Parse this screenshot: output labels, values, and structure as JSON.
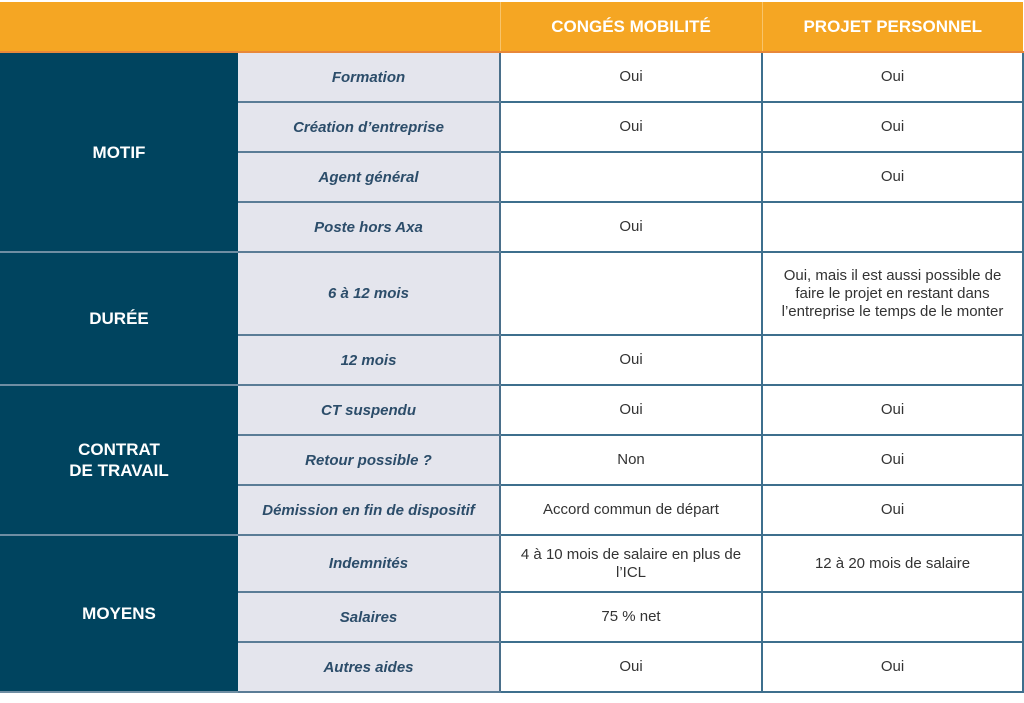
{
  "header": {
    "corner": "",
    "columns": [
      "CONGÉS MOBILITÉ",
      "PROJET PERSONNEL"
    ]
  },
  "colors": {
    "header_bg": "#f5a623",
    "group_bg": "#00445f",
    "label_bg": "#e4e5ed",
    "label_text": "#2c4d6a",
    "border": "#3e6f8d"
  },
  "groups": [
    {
      "name": "MOTIF",
      "rows": [
        {
          "label": "Formation",
          "conges_mobilite": "Oui",
          "projet_personnel": "Oui"
        },
        {
          "label": "Création d’entreprise",
          "conges_mobilite": "Oui",
          "projet_personnel": "Oui"
        },
        {
          "label": "Agent général",
          "conges_mobilite": "",
          "projet_personnel": "Oui"
        },
        {
          "label": "Poste hors Axa",
          "conges_mobilite": "Oui",
          "projet_personnel": ""
        }
      ]
    },
    {
      "name": "DURÉE",
      "rows": [
        {
          "label": "6 à 12 mois",
          "conges_mobilite": "",
          "projet_personnel": "Oui, mais il est aussi possible de faire le projet en restant dans l’entreprise le temps de le monter"
        },
        {
          "label": "12 mois",
          "conges_mobilite": "Oui",
          "projet_personnel": ""
        }
      ]
    },
    {
      "name_line1": "CONTRAT",
      "name_line2": "DE TRAVAIL",
      "rows": [
        {
          "label": "CT suspendu",
          "conges_mobilite": "Oui",
          "projet_personnel": "Oui"
        },
        {
          "label": "Retour possible ?",
          "conges_mobilite": "Non",
          "projet_personnel": "Oui"
        },
        {
          "label": "Démission en fin de dispositif",
          "conges_mobilite": "Accord commun de départ",
          "projet_personnel": "Oui"
        }
      ]
    },
    {
      "name": "MOYENS",
      "rows": [
        {
          "label": "Indemnités",
          "conges_mobilite": "4 à 10 mois de salaire en plus de l’ICL",
          "projet_personnel": "12 à 20 mois de salaire"
        },
        {
          "label": "Salaires",
          "conges_mobilite": "75 % net",
          "projet_personnel": ""
        },
        {
          "label": "Autres aides",
          "conges_mobilite": "Oui",
          "projet_personnel": "Oui"
        }
      ]
    }
  ]
}
